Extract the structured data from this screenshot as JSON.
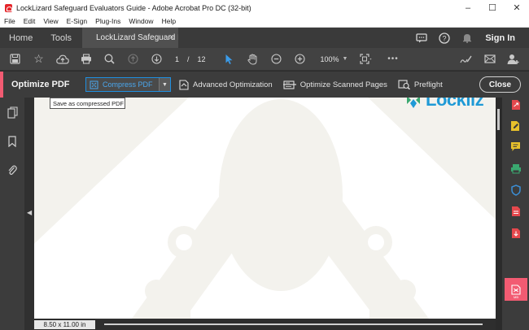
{
  "window": {
    "title": "LockLizard Safeguard Evaluators Guide - Adobe Acrobat Pro DC (32-bit)",
    "controls": {
      "minimize": "–",
      "maximize": "☐",
      "close": "✕"
    }
  },
  "menu": [
    "File",
    "Edit",
    "View",
    "E-Sign",
    "Plug-Ins",
    "Window",
    "Help"
  ],
  "tabs": {
    "home": "Home",
    "tools": "Tools",
    "document": "LockLizard Safeguard Evaluators Guide",
    "document_close": "×",
    "sign_in": "Sign In"
  },
  "toolbar": {
    "current_page": "1",
    "page_separator": "/",
    "total_pages": "12",
    "zoom": "100%",
    "more": "•••"
  },
  "optimize_bar": {
    "label": "Optimize PDF",
    "compress_label": "Compress PDF",
    "compress_tooltip": "Save as compressed PDF",
    "advanced": "Advanced Optimization",
    "scanned": "Optimize Scanned Pages",
    "preflight": "Preflight",
    "close": "Close"
  },
  "document": {
    "logo_text": "Lockliz",
    "page_size": "8.50 x 11.00 in"
  },
  "colors": {
    "accent": "#f25b72",
    "highlight": "#1f8fe0",
    "logo_blue": "#1f9ad6",
    "logo_green": "#3aa870"
  },
  "right_tools": [
    {
      "name": "export-pdf-icon",
      "glyph": "⇪",
      "color": "#e5484d"
    },
    {
      "name": "edit-pdf-icon",
      "glyph": "✎",
      "color": "#e8c12b"
    },
    {
      "name": "comment-icon",
      "glyph": "▭",
      "color": "#e8c12b"
    },
    {
      "name": "scan-ocr-icon",
      "glyph": "▤",
      "color": "#3aa870"
    },
    {
      "name": "protect-icon",
      "glyph": "⛉",
      "color": "#3b8fd6"
    },
    {
      "name": "create-pdf-icon",
      "glyph": "▥",
      "color": "#e5484d"
    },
    {
      "name": "combine-icon",
      "glyph": "⇩",
      "color": "#e5484d"
    },
    {
      "name": "optimize-pdf-icon",
      "glyph": "▣",
      "color": "#ffffff",
      "sub": "MB",
      "active": true
    }
  ]
}
